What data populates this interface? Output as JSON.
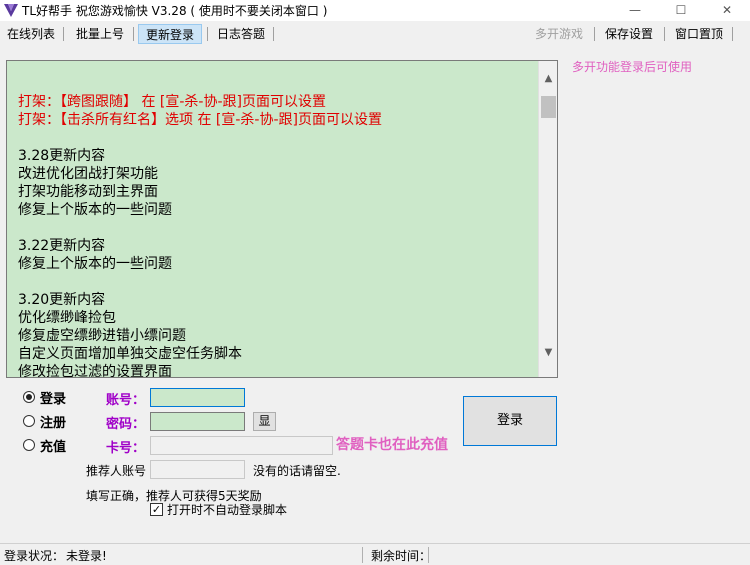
{
  "window": {
    "title": "TL好帮手 祝您游戏愉快 V3.28 ( 使用时不要关闭本窗口 )",
    "min_glyph": "—",
    "max_glyph": "☐",
    "close_glyph": "✕"
  },
  "menu": {
    "items": [
      {
        "label": "在线列表"
      },
      {
        "label": "批量上号"
      },
      {
        "label": "更新登录"
      },
      {
        "label": "日志答题"
      }
    ],
    "right": [
      {
        "label": "多开游戏"
      },
      {
        "label": "保存设置"
      },
      {
        "label": "窗口置顶"
      }
    ]
  },
  "side_note": "多开功能登录后可使用",
  "log": {
    "red_lines": [
      "打架：【跨图跟随】 在 [宣-杀-协-跟]页面可以设置",
      "打架：【击杀所有红名】选项 在 [宣-杀-协-跟]页面可以设置"
    ],
    "v328": [
      "3.28更新内容",
      "改进优化团战打架功能",
      "打架功能移动到主界面",
      "修复上个版本的一些问题"
    ],
    "v322": [
      "3.22更新内容",
      "修复上个版本的一些问题"
    ],
    "v320": [
      "3.20更新内容",
      "优化缥缈峰捡包",
      "修复虚空缥缈进错小缥问题",
      "自定义页面增加单独交虚空任务脚本",
      "修改捡包过滤的设置界面"
    ]
  },
  "scroll": {
    "up_glyph": "▲",
    "down_glyph": "▼"
  },
  "login": {
    "radio_login": "登录",
    "radio_register": "注册",
    "radio_recharge": "充值",
    "account_label": "账号：",
    "password_label": "密码：",
    "card_label": "卡号：",
    "account_value": "",
    "password_value": "",
    "card_value": "",
    "show_button": "显",
    "login_button": "登录",
    "card_note": "答题卡也在此充值",
    "referrer_label": "推荐人账号",
    "referrer_value": "",
    "referrer_note": "没有的话请留空.",
    "reward_note": "填写正确，推荐人可获得5天奖励",
    "autologin_label": "打开时不自动登录脚本",
    "check_glyph": "✓"
  },
  "status": {
    "login_status_label": "登录状况：",
    "login_status_value": "未登录!",
    "remaining_label": "剩余时间："
  },
  "colors": {
    "log_bg": "#cbe8cb",
    "red_text": "#e00000",
    "label_purple": "#a000c8",
    "note_pink": "#e060c0"
  }
}
